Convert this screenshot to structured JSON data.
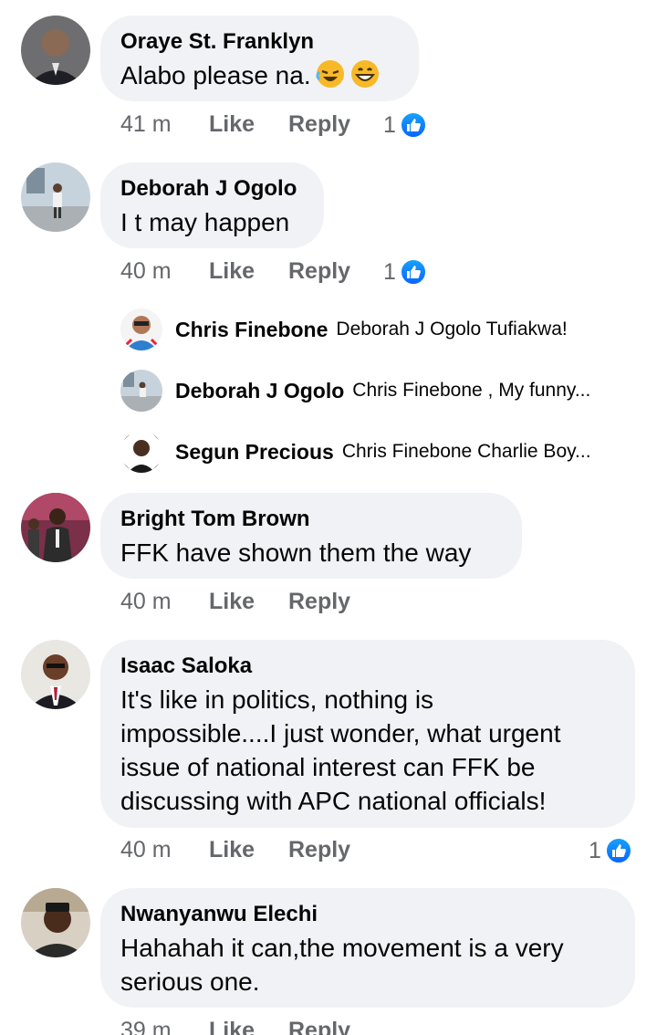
{
  "like_label": "Like",
  "reply_label": "Reply",
  "comments": [
    {
      "author": "Oraye St. Franklyn",
      "text": "Alabo please na.",
      "emojis": [
        "rofl-emoji",
        "grin-emoji"
      ],
      "time": "41 m",
      "likes": "1"
    },
    {
      "author": "Deborah J Ogolo",
      "text": "I t may happen",
      "time": "40 m",
      "likes": "1",
      "replies": [
        {
          "name": "Chris Finebone",
          "text": "Deborah J Ogolo Tufiakwa!"
        },
        {
          "name": "Deborah J Ogolo",
          "text": "Chris Finebone , My funny..."
        },
        {
          "name": "Segun Precious",
          "text": "Chris Finebone Charlie Boy..."
        }
      ]
    },
    {
      "author": "Bright Tom Brown",
      "text": "FFK have shown them the way",
      "time": "40 m"
    },
    {
      "author": "Isaac Saloka",
      "text_lines": [
        "It's like in politics, nothing is",
        "impossible....I just wonder, what urgent",
        "issue of national interest can FFK be",
        "discussing with APC national officials!"
      ],
      "time": "40 m",
      "likes": "1"
    },
    {
      "author": "Nwanyanwu Elechi",
      "text_lines": [
        "Hahahah it can,the movement is a very",
        "serious one."
      ],
      "time": "39 m"
    }
  ]
}
